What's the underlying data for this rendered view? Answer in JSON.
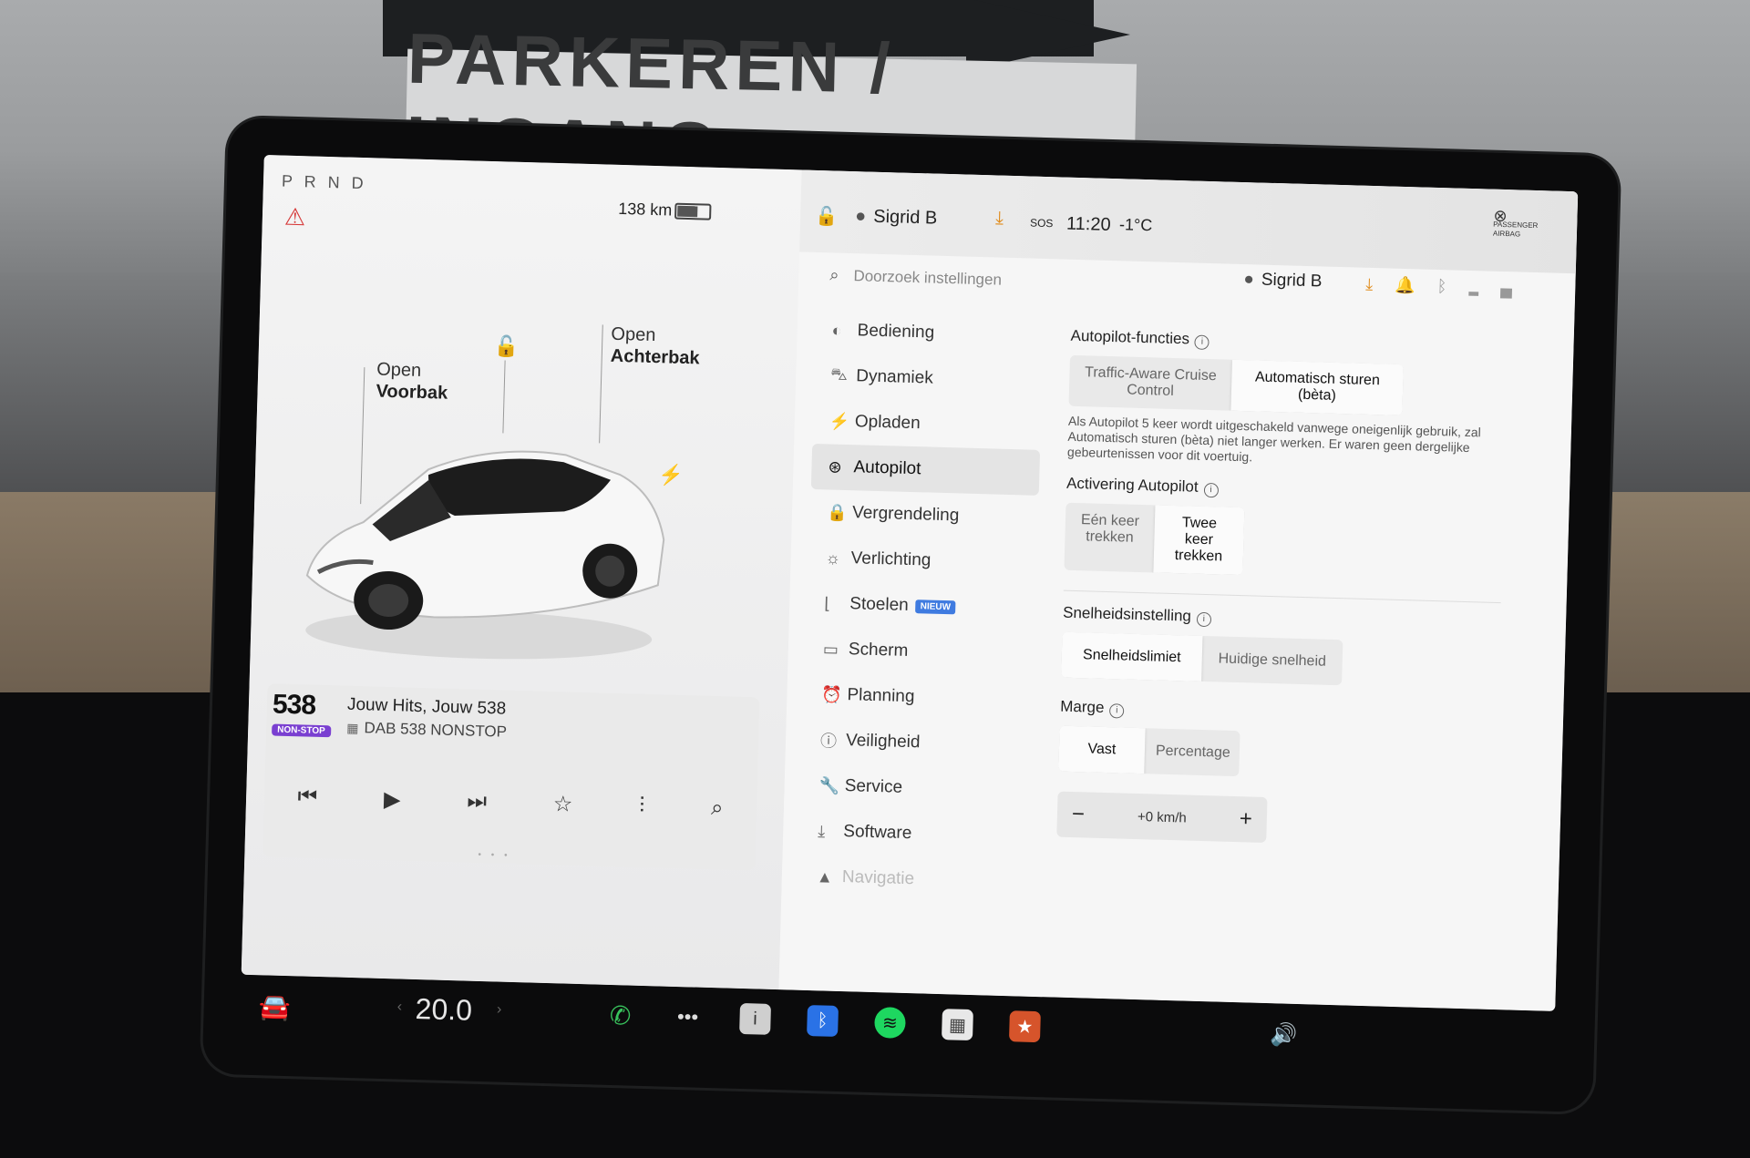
{
  "background": {
    "sign_text": "PARKEREN / INGANG"
  },
  "car_panel": {
    "gear": "P R N D",
    "range": "138 km",
    "frunk": {
      "line1": "Open",
      "line2": "Voorbak"
    },
    "trunk": {
      "line1": "Open",
      "line2": "Achterbak"
    },
    "icons": {
      "seatbelt": "seatbelt-warning-icon",
      "lock": "unlock-icon",
      "charge": "charge-port-icon"
    }
  },
  "media": {
    "station_logo": "538",
    "station_badge": "NON-STOP",
    "track_title": "Jouw Hits, Jouw 538",
    "station_name": "DAB 538 NONSTOP",
    "controls": [
      "previous-icon",
      "play-icon",
      "next-icon",
      "favorite-icon",
      "equalizer-icon",
      "search-icon"
    ]
  },
  "status_bar": {
    "user": "Sigrid B",
    "sos": "SOS",
    "time": "11:20",
    "temperature": "-1°C",
    "airbag_line1": "PASSENGER",
    "airbag_line2": "AIRBAG"
  },
  "settings": {
    "search_placeholder": "Doorzoek instellingen",
    "user": "Sigrid B",
    "nav": [
      {
        "label": "Bediening",
        "icon": "toggle-icon"
      },
      {
        "label": "Dynamiek",
        "icon": "car-icon"
      },
      {
        "label": "Opladen",
        "icon": "bolt-icon"
      },
      {
        "label": "Autopilot",
        "icon": "steering-wheel-icon",
        "active": true
      },
      {
        "label": "Vergrendeling",
        "icon": "lock-icon"
      },
      {
        "label": "Verlichting",
        "icon": "sun-icon"
      },
      {
        "label": "Stoelen",
        "icon": "seat-icon",
        "badge": "NIEUW"
      },
      {
        "label": "Scherm",
        "icon": "display-icon"
      },
      {
        "label": "Planning",
        "icon": "clock-icon"
      },
      {
        "label": "Veiligheid",
        "icon": "info-circle-icon"
      },
      {
        "label": "Service",
        "icon": "wrench-icon"
      },
      {
        "label": "Software",
        "icon": "download-icon"
      },
      {
        "label": "Navigatie",
        "icon": "navigation-icon"
      }
    ],
    "autopilot_functions": {
      "title": "Autopilot-functies",
      "options": [
        "Traffic-Aware Cruise Control",
        "Automatisch sturen (bèta)"
      ],
      "selected": "Automatisch sturen (bèta)",
      "description": "Als Autopilot 5 keer wordt uitgeschakeld vanwege oneigenlijk gebruik, zal Automatisch sturen (bèta) niet langer werken. Er waren geen dergelijke gebeurtenissen voor dit voertuig."
    },
    "activation": {
      "title": "Activering Autopilot",
      "options": [
        "Eén keer trekken",
        "Twee keer trekken"
      ],
      "selected": "Twee keer trekken"
    },
    "speed_setting": {
      "title": "Snelheidsinstelling",
      "options": [
        "Snelheidslimiet",
        "Huidige snelheid"
      ],
      "selected": "Snelheidslimiet"
    },
    "margin": {
      "title": "Marge",
      "options": [
        "Vast",
        "Percentage"
      ],
      "selected": "Vast",
      "value": "+0 km/h"
    }
  },
  "dock": {
    "temperature": "20.0",
    "apps": [
      "phone-icon",
      "more-icon",
      "manual-icon",
      "bluetooth-icon",
      "spotify-icon",
      "calendar-icon",
      "toybox-icon"
    ],
    "volume": "volume-icon"
  }
}
